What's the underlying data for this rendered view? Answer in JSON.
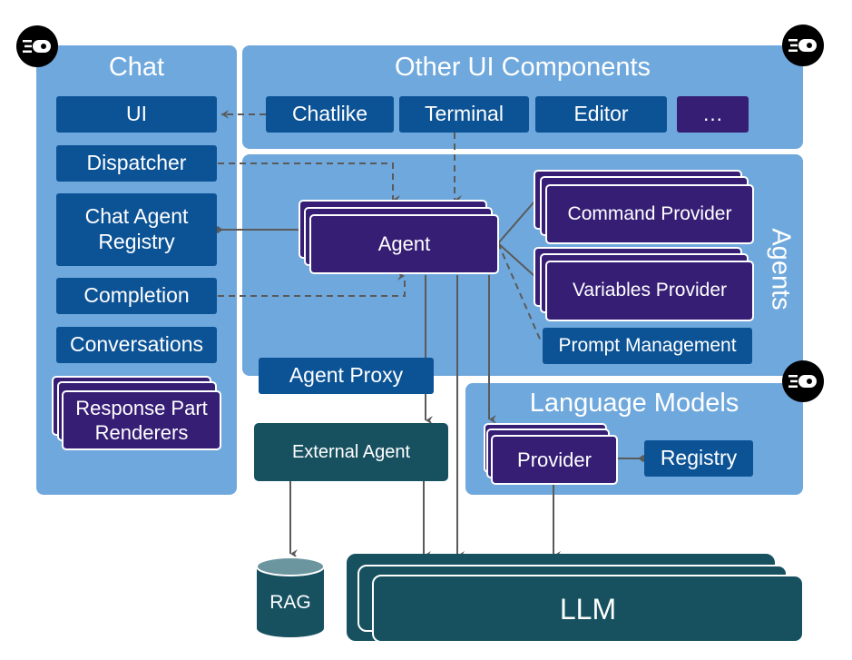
{
  "chat": {
    "title": "Chat",
    "items": {
      "ui": "UI",
      "dispatcher": "Dispatcher",
      "chat_agent_registry": "Chat Agent Registry",
      "completion": "Completion",
      "conversations": "Conversations",
      "response_part_renderers": "Response Part Renderers"
    }
  },
  "other_ui": {
    "title": "Other UI Components",
    "items": [
      "Chatlike",
      "Terminal",
      "Editor",
      "…"
    ]
  },
  "agents": {
    "title": "Agents",
    "agent": "Agent",
    "command_provider": "Command Provider",
    "variables_provider": "Variables Provider",
    "prompt_management": "Prompt Management",
    "agent_proxy": "Agent Proxy"
  },
  "external_agent": "External Agent",
  "language_models": {
    "title": "Language Models",
    "provider": "Provider",
    "registry": "Registry"
  },
  "rag": "RAG",
  "llm": "LLM",
  "colors": {
    "panel": "#6fa8dc",
    "box_blue": "#0c5396",
    "box_purple": "#361e75",
    "box_teal": "#175160",
    "connector": "#5a5a5a"
  }
}
